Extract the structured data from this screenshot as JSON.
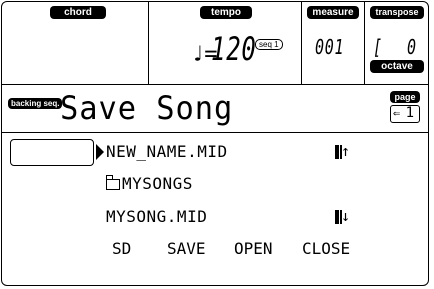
{
  "status": {
    "chord_label": "chord",
    "tempo_label": "tempo",
    "tempo_note": "♩=",
    "tempo_value": "120",
    "seq_badge": "seq 1",
    "measure_label": "measure",
    "measure_value": "001",
    "transpose_label": "transpose",
    "transpose_value_left": "[",
    "transpose_value_right": "0",
    "octave_label": "octave"
  },
  "header": {
    "mode_badge": "backing seq.",
    "title": "Save Song",
    "page_label": "page",
    "page_arrow": "⇐",
    "page_number": "1"
  },
  "files": [
    {
      "name": "NEW_NAME.MID",
      "type": "file"
    },
    {
      "name": "MYSONGS",
      "type": "folder"
    },
    {
      "name": "MYSONG.MID",
      "type": "file"
    }
  ],
  "scroll": {
    "up": "↑",
    "down": "↓"
  },
  "softkeys": [
    "SD",
    "SAVE",
    "OPEN",
    "CLOSE"
  ]
}
